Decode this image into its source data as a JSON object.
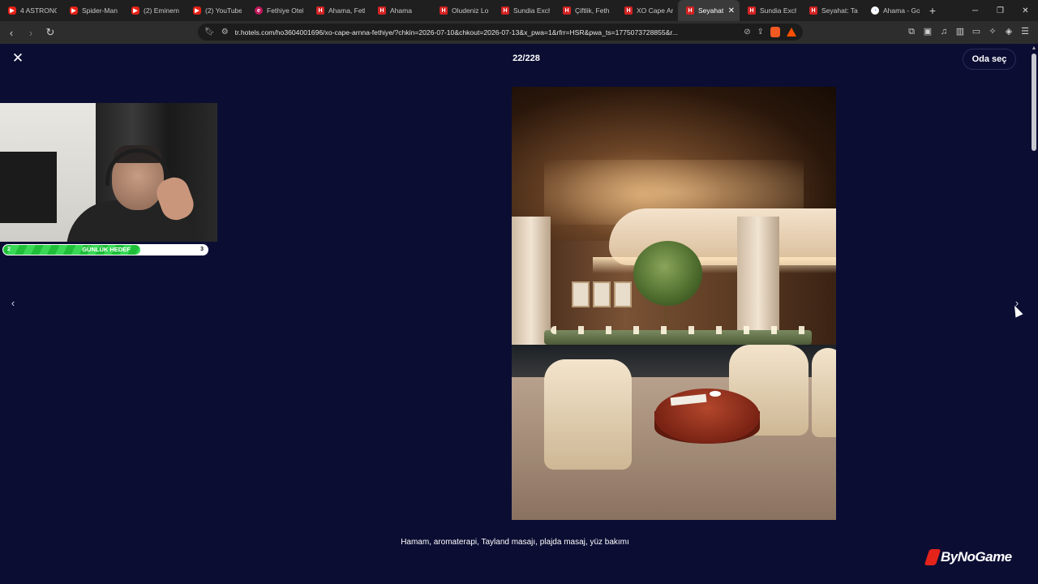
{
  "browser": {
    "tabs": [
      {
        "title": "4 ASTRONO",
        "favicon": "youtube-icon",
        "active": false
      },
      {
        "title": "Spider-Man",
        "favicon": "youtube-icon",
        "active": false
      },
      {
        "title": "(2) Eminem",
        "favicon": "youtube-icon",
        "active": false
      },
      {
        "title": "(2) YouTube",
        "favicon": "youtube-icon",
        "active": false
      },
      {
        "title": "Fethiye Otel",
        "favicon": "fe-icon",
        "active": false
      },
      {
        "title": "Ahama, Feth",
        "favicon": "hotels-icon",
        "active": false
      },
      {
        "title": "Ahama",
        "favicon": "hotels-icon",
        "active": false
      },
      {
        "title": "Oludeniz Lo",
        "favicon": "hotels-icon",
        "active": false
      },
      {
        "title": "Sundia Exch",
        "favicon": "hotels-icon",
        "active": false
      },
      {
        "title": "Çiftlik, Feth",
        "favicon": "hotels-icon",
        "active": false
      },
      {
        "title": "XO Cape Ar",
        "favicon": "hotels-icon",
        "active": false
      },
      {
        "title": "Seyahat",
        "favicon": "hotels-icon",
        "active": true
      },
      {
        "title": "Sundia Exch",
        "favicon": "hotels-icon",
        "active": false
      },
      {
        "title": "Seyahat: Tat",
        "favicon": "hotels-icon",
        "active": false
      },
      {
        "title": "Ahama - Go",
        "favicon": "google-icon",
        "active": false
      }
    ],
    "url": "tr.hotels.com/ho3604001696/xo-cape-arnna-fethiye/?chkin=2026-07-10&chkout=2026-07-13&x_pwa=1&rfrr=HSR&pwa_ts=1775073728855&r..."
  },
  "gallery": {
    "counter": "22/228",
    "select_room_label": "Oda seç",
    "caption": "Hamam, aromaterapi, Tayland masajı, plajda masaj, yüz bakımı"
  },
  "overlay": {
    "goal_label": "GÜNLÜK HEDEF",
    "goal_current": "2",
    "goal_target": "3",
    "goal_progress": 0.67,
    "brand": "ByNoGame"
  },
  "colors": {
    "page_background": "#0b0d33",
    "goal_fill": "#1fbf3a",
    "brand_red": "#e4231b"
  }
}
